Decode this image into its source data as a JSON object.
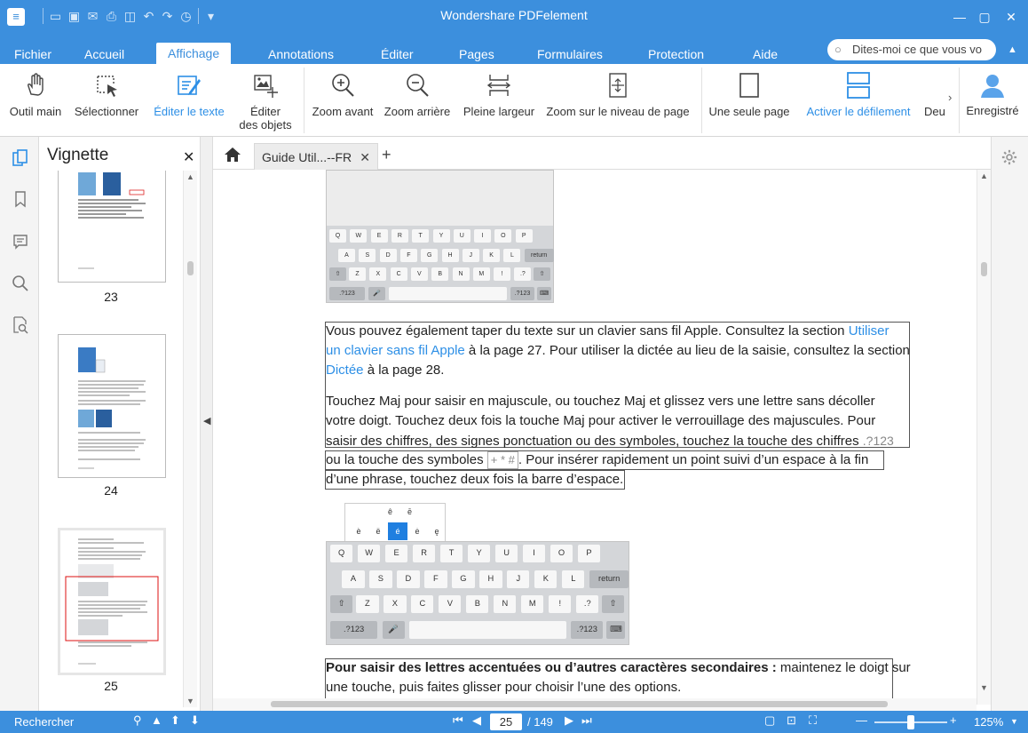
{
  "app": {
    "title": "Wondershare PDFelement"
  },
  "menu": {
    "tabs": [
      {
        "label": "Fichier"
      },
      {
        "label": "Accueil"
      },
      {
        "label": "Affichage"
      },
      {
        "label": "Annotations"
      },
      {
        "label": "Éditer"
      },
      {
        "label": "Pages"
      },
      {
        "label": "Formulaires"
      },
      {
        "label": "Protection"
      },
      {
        "label": "Aide"
      }
    ],
    "search_placeholder": "Dites-moi ce que vous vo"
  },
  "ribbon": {
    "items": [
      {
        "label": "Outil main",
        "icon": "hand-icon"
      },
      {
        "label": "Sélectionner",
        "icon": "select-cursor-icon"
      },
      {
        "label": "Éditer le texte",
        "icon": "edit-text-icon",
        "active": true
      },
      {
        "label": "Éditer\ndes objets",
        "icon": "edit-objects-icon"
      },
      {
        "label": "Zoom avant",
        "icon": "zoom-in-icon"
      },
      {
        "label": "Zoom arrière",
        "icon": "zoom-out-icon"
      },
      {
        "label": "Pleine largeur",
        "icon": "fit-width-icon"
      },
      {
        "label": "Zoom sur le niveau de page",
        "icon": "fit-page-icon"
      },
      {
        "label": "Une seule page",
        "icon": "single-page-icon"
      },
      {
        "label": "Activer le défilement",
        "icon": "scroll-mode-icon",
        "active": true
      },
      {
        "label": "Deu",
        "icon": "two-page-icon"
      },
      {
        "label": "Enregistré",
        "icon": "user-icon"
      }
    ]
  },
  "thumbnails": {
    "title": "Vignette",
    "pages": [
      {
        "number": "23"
      },
      {
        "number": "24"
      },
      {
        "number": "25"
      }
    ]
  },
  "document": {
    "tab_label": "Guide Util...--FR",
    "para1_line1_pre": "Vous pouvez également taper du texte sur un clavier sans fil Apple. Consultez la section ",
    "para1_link1a": "Utiliser",
    "para1_link1b": "un clavier sans fil Apple",
    "para1_line2_post": " à la page 27. Pour utiliser la dictée au lieu de la saisie, consultez la section",
    "para1_link2": "Dictée",
    "para1_line3_post": " à la page 28.",
    "para2_line1": "Touchez Maj pour saisir en majuscule, ou touchez Maj et glissez vers une lettre sans décoller",
    "para2_line2": "votre doigt. Touchez deux fois la touche Maj pour activer le verrouillage des majuscules. Pour",
    "para2_line3": "saisir des chiffres, des signes ponctuation ou des symboles, touchez la touche des chiffres",
    "key_numbers": ".?123",
    "para2_line4_pre": "ou la touche des symboles",
    "key_symbols": "+ * #",
    "para2_line4_post": ". Pour insérer rapidement un point suivi d’un espace à la fin",
    "para2_line5": "d’une phrase, touchez deux fois la barre d’espace.",
    "para3_bold": "Pour saisir des lettres accentuées ou d’autres caractères secondaires :",
    "para3_rest": " maintenez le doigt sur",
    "para3_line2": "une touche, puis faites glisser pour choisir l’une des options.",
    "keyboard1": {
      "row1": [
        "Q",
        "W",
        "E",
        "R",
        "T",
        "Y",
        "U",
        "I",
        "O",
        "P"
      ],
      "row2": [
        "A",
        "S",
        "D",
        "F",
        "G",
        "H",
        "J",
        "K",
        "L",
        "return"
      ],
      "row3": [
        "Z",
        "X",
        "C",
        "V",
        "B",
        "N",
        "M",
        "!",
        ".?"
      ],
      "row4": [
        ".?123",
        ".?123"
      ]
    },
    "keyboard2": {
      "accents": [
        "è",
        "ê",
        "é",
        "ë",
        "ē",
        "ė",
        "ę"
      ],
      "row1": [
        "Q",
        "W",
        "E",
        "R",
        "T",
        "Y",
        "U",
        "I",
        "O",
        "P"
      ],
      "row2": [
        "A",
        "S",
        "D",
        "F",
        "G",
        "H",
        "J",
        "K",
        "L",
        "return"
      ],
      "row3": [
        "Z",
        "X",
        "C",
        "V",
        "B",
        "N",
        "M",
        "!",
        ".?"
      ],
      "row4": [
        ".?123",
        ".?123"
      ]
    }
  },
  "status": {
    "search_label": "Rechercher",
    "current_page": "25",
    "page_total": "/ 149",
    "zoom": "125%"
  }
}
